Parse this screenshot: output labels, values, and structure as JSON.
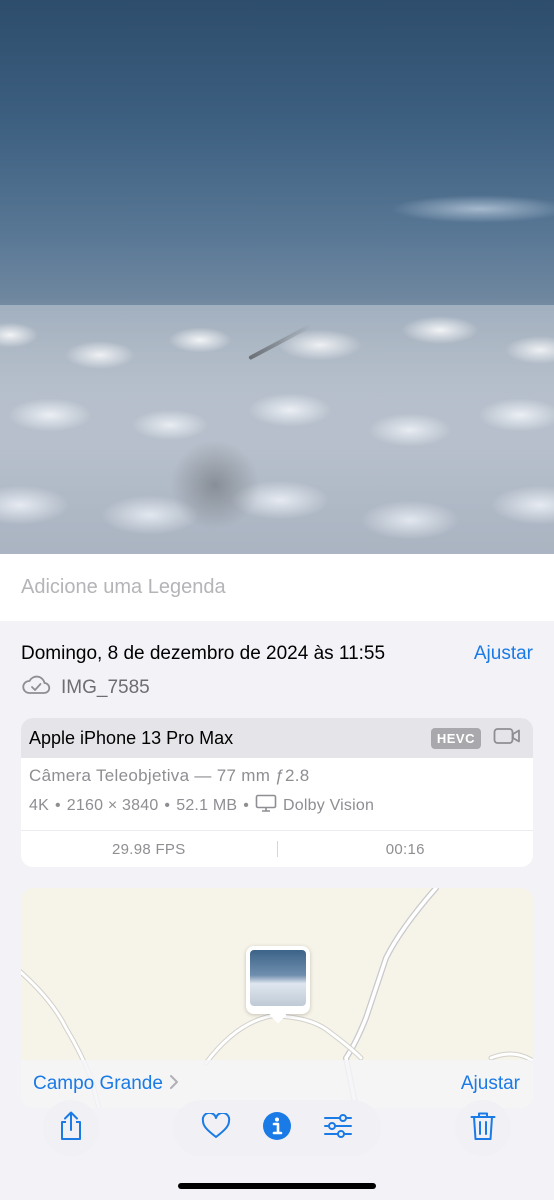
{
  "caption": {
    "placeholder": "Adicione uma Legenda"
  },
  "info": {
    "date": "Domingo, 8 de dezembro de 2024 às 11:55",
    "adjust_label": "Ajustar",
    "filename": "IMG_7585"
  },
  "camera": {
    "device": "Apple iPhone 13 Pro Max",
    "format_badge": "HEVC",
    "lens": "Câmera Teleobjetiva — 77 mm ƒ2.8",
    "resolution_label": "4K",
    "dimensions": "2160 × 3840",
    "size": "52.1 MB",
    "hdr": "Dolby Vision",
    "separator": "•",
    "fps": "29.98 FPS",
    "duration": "00:16"
  },
  "map": {
    "place": "Campo Grande",
    "adjust_label": "Ajustar"
  },
  "toolbar": {
    "icons": [
      "share-icon",
      "heart-icon",
      "info-icon",
      "adjust-icon",
      "trash-icon"
    ]
  },
  "colors": {
    "accent": "#1a7ae6",
    "secondary_text": "#8e8e93",
    "card_header": "#e4e4e9",
    "map_background": "#f6f3e8"
  }
}
